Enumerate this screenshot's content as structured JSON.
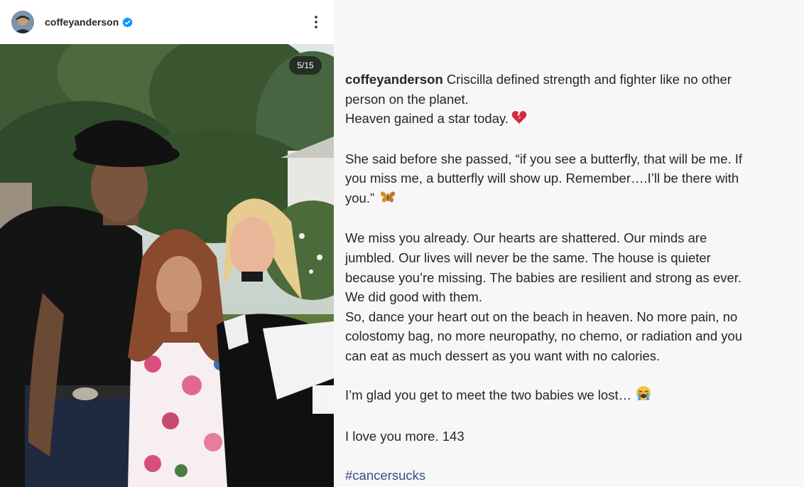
{
  "post": {
    "username": "coffeyanderson",
    "slide_counter": "5/15"
  },
  "caption": {
    "handle": "coffeyanderson",
    "line1": "Criscilla defined strength and fighter like no other",
    "line2": "person on the planet.",
    "line3": "Heaven gained a star today.",
    "para2_line1": "She said before she passed, “if you see a butterfly, that will be me. If",
    "para2_line2": "you miss me, a butterfly will show up. Remember….I’ll be there with",
    "para2_line3": "you.”",
    "para3_line1": "We miss you already. Our hearts are shattered. Our minds are",
    "para3_line2": "jumbled. Our lives will never be the same. The house is quieter",
    "para3_line3": "because you’re missing. The babies are resilient and strong as ever.",
    "para3_line4": "We did good with them.",
    "para3_line5": "So, dance your heart out on the beach in heaven. No more pain, no",
    "para3_line6": "colostomy bag, no more neuropathy, no chemo, or radiation and you",
    "para3_line7": "can eat as much dessert as you want with no calories.",
    "para4": "I’m glad you get to meet the two babies we lost…",
    "para5": "I love you more. 143",
    "hashtag": "#cancersucks"
  },
  "icons": {
    "verified": "verified-badge-icon",
    "more": "more-options-icon",
    "broken_heart": "broken-heart-emoji",
    "butterfly": "butterfly-emoji",
    "crying": "crying-face-emoji"
  },
  "colors": {
    "verified_blue": "#0095f6",
    "hashtag": "#3a4f8a",
    "text": "#262626"
  }
}
